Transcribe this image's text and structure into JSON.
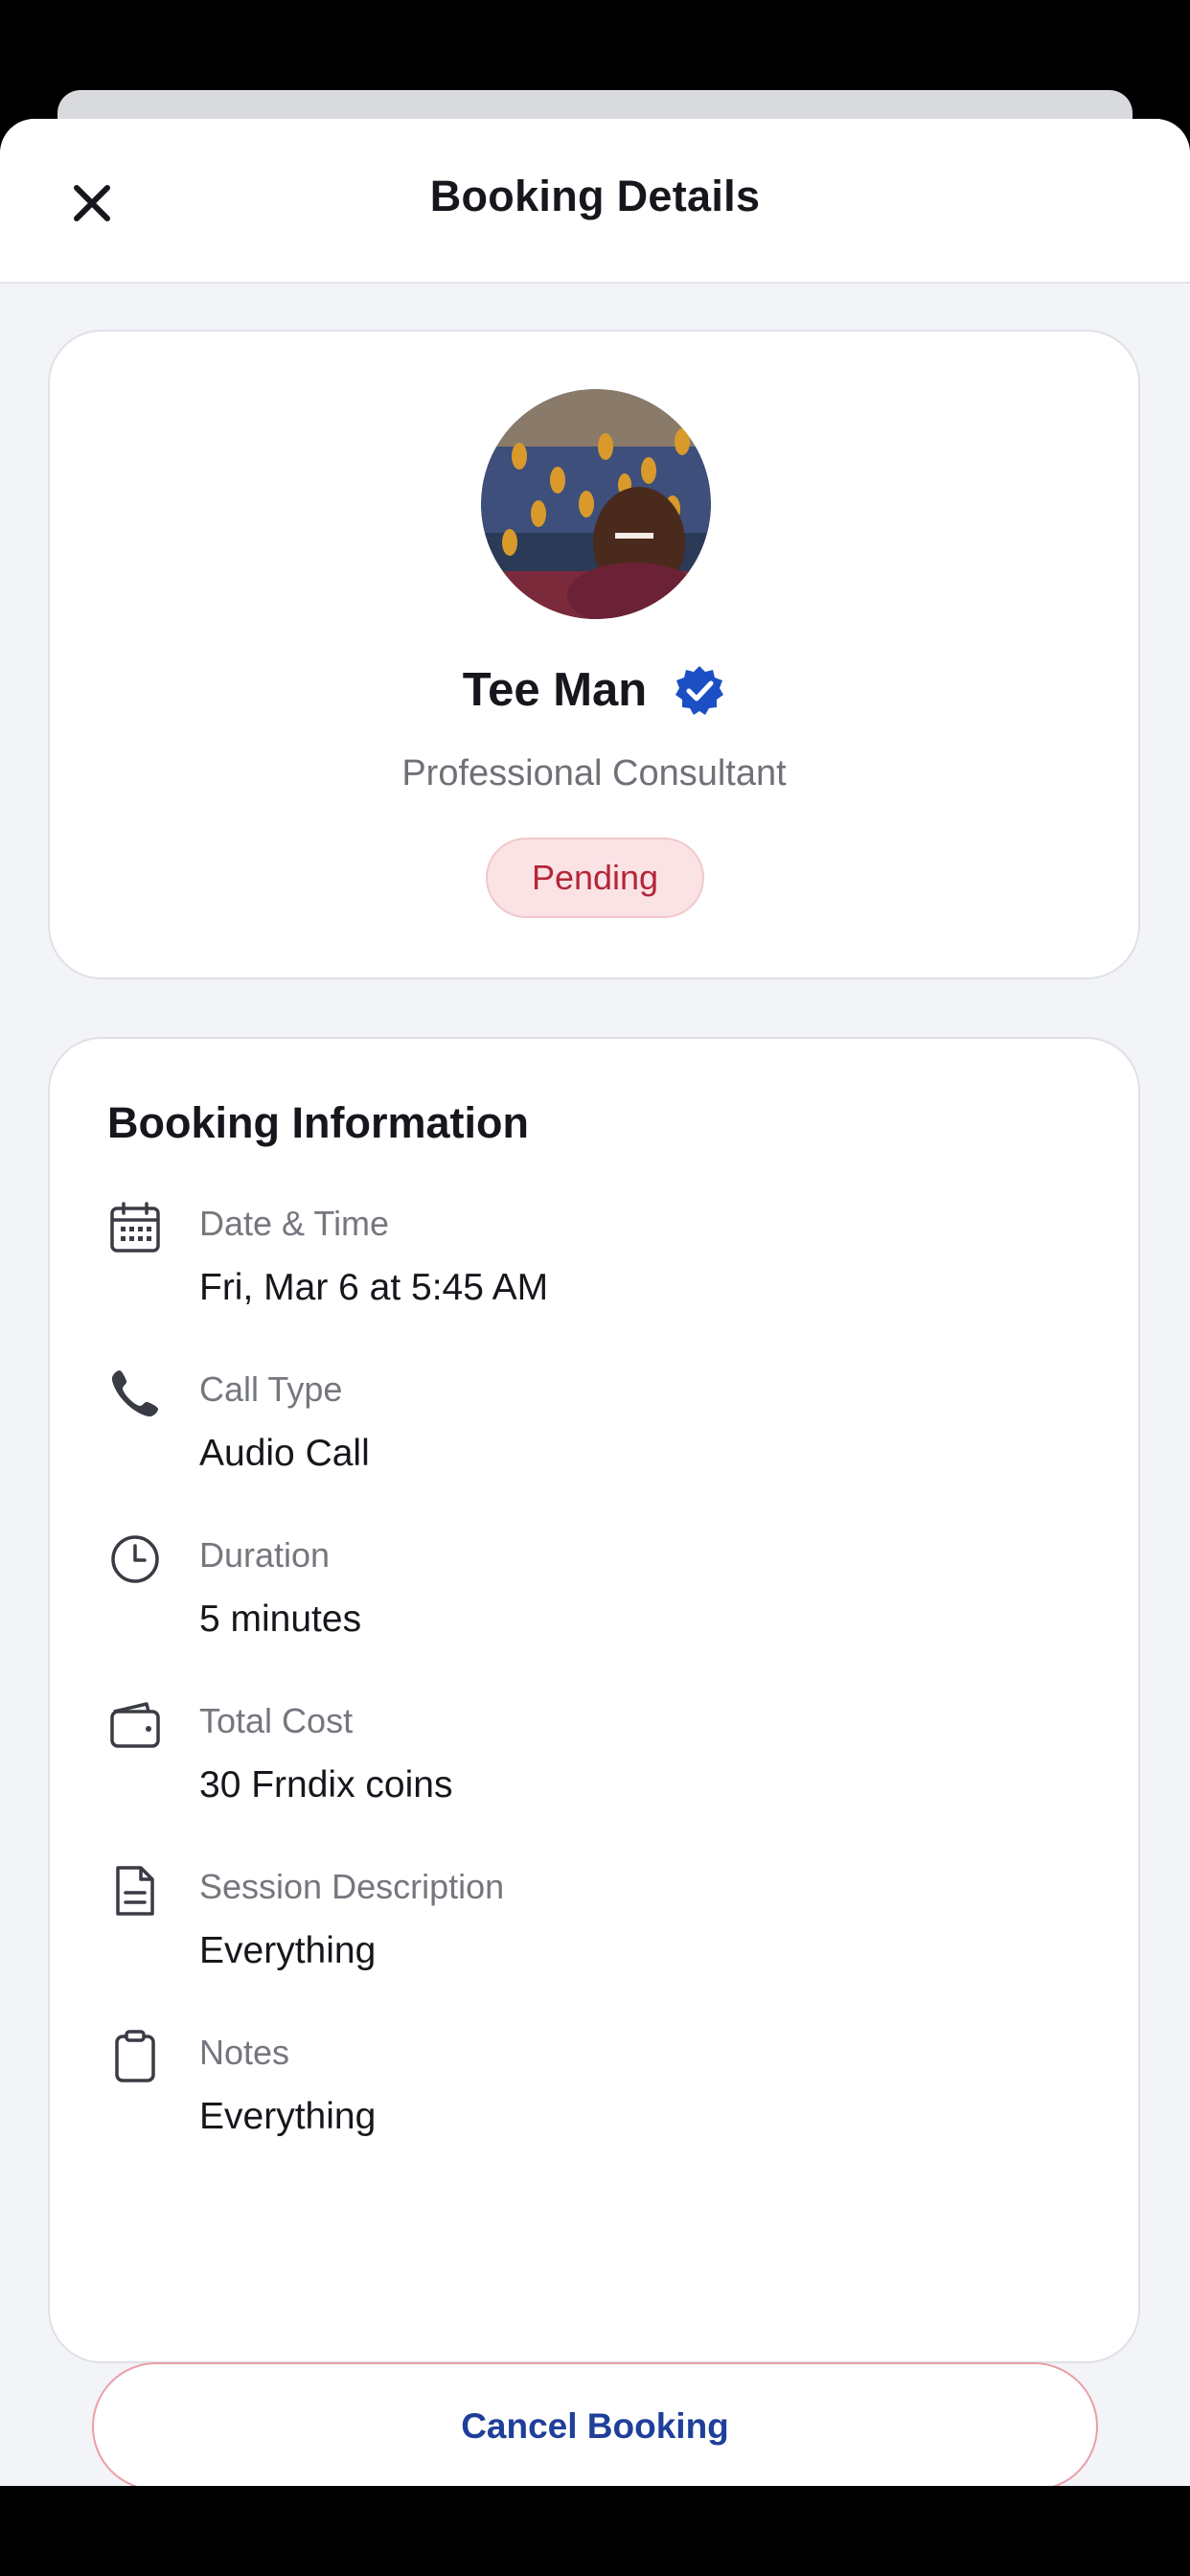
{
  "header": {
    "title": "Booking Details",
    "close_icon": "close-icon"
  },
  "profile": {
    "name": "Tee Man",
    "verified_icon": "verified-badge-icon",
    "role": "Professional Consultant",
    "status": "Pending"
  },
  "booking_info": {
    "title": "Booking Information",
    "rows": [
      {
        "icon": "calendar-icon",
        "label": "Date & Time",
        "value": "Fri, Mar 6 at 5:45 AM"
      },
      {
        "icon": "phone-icon",
        "label": "Call Type",
        "value": "Audio Call"
      },
      {
        "icon": "clock-icon",
        "label": "Duration",
        "value": "5 minutes"
      },
      {
        "icon": "wallet-icon",
        "label": "Total Cost",
        "value": "30 Frndix coins"
      },
      {
        "icon": "document-icon",
        "label": "Session Description",
        "value": "Everything"
      },
      {
        "icon": "clipboard-icon",
        "label": "Notes",
        "value": "Everything"
      }
    ]
  },
  "actions": {
    "cancel_label": "Cancel Booking"
  },
  "colors": {
    "accent_blue": "#1f3f9a",
    "verified_blue": "#1c4fc4",
    "pending_text": "#b3263a",
    "pending_bg": "#fbe3e5",
    "cancel_border": "#ea9fa7"
  }
}
